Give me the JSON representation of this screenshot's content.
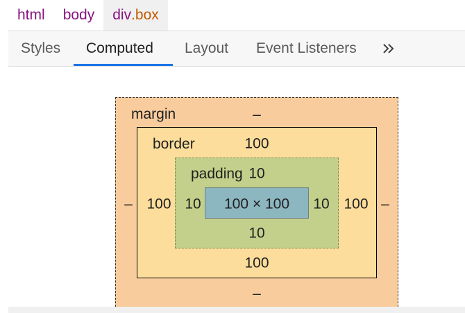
{
  "breadcrumb": {
    "items": [
      {
        "tag": "html"
      },
      {
        "tag": "body"
      },
      {
        "tag": "div",
        "class": ".box"
      }
    ]
  },
  "tabs": {
    "items": [
      "Styles",
      "Computed",
      "Layout",
      "Event Listeners"
    ],
    "active": "Computed",
    "more_icon": "double-chevron-right-icon"
  },
  "box_model": {
    "margin": {
      "label": "margin",
      "top": "–",
      "right": "–",
      "bottom": "–",
      "left": "–"
    },
    "border": {
      "label": "border",
      "top": "100",
      "right": "100",
      "bottom": "100",
      "left": "100"
    },
    "padding": {
      "label": "padding",
      "top": "10",
      "right": "10",
      "bottom": "10",
      "left": "10"
    },
    "content": {
      "size": "100 × 100"
    },
    "colors": {
      "margin": "#f9cc9d",
      "border": "#fddd9b",
      "padding": "#c3d08b",
      "content": "#8cb6c0"
    }
  }
}
